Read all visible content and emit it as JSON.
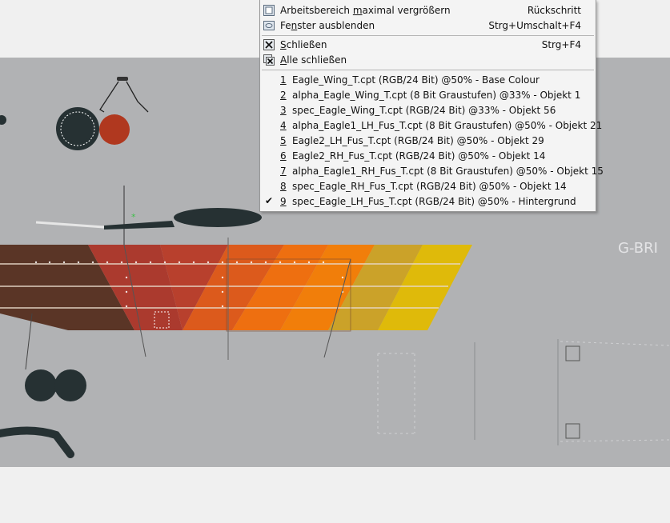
{
  "menu": {
    "window_items": [
      {
        "pre": "Arbeitsbereich ",
        "acc": "m",
        "post": "aximal vergrößern",
        "shortcut": "Rückschritt",
        "icon": "maximize-window-icon"
      },
      {
        "pre": "Fe",
        "acc": "n",
        "post": "ster ausblenden",
        "shortcut": "Strg+Umschalt+F4",
        "icon": "hide-window-icon"
      }
    ],
    "close_items": [
      {
        "pre": "",
        "acc": "S",
        "post": "chließen",
        "shortcut": "Strg+F4",
        "icon": "close-window-icon"
      },
      {
        "pre": "",
        "acc": "A",
        "post": "lle schließen",
        "shortcut": "",
        "icon": "close-all-windows-icon"
      }
    ],
    "documents": [
      {
        "num": "1",
        "label": "Eagle_Wing_T.cpt (RGB/24 Bit) @50% - Base Colour",
        "checked": false
      },
      {
        "num": "2",
        "label": "alpha_Eagle_Wing_T.cpt (8 Bit Graustufen) @33% - Objekt 1",
        "checked": false
      },
      {
        "num": "3",
        "label": "spec_Eagle_Wing_T.cpt (RGB/24 Bit) @33% - Objekt 56",
        "checked": false
      },
      {
        "num": "4",
        "label": "alpha_Eagle1_LH_Fus_T.cpt (8 Bit Graustufen) @50% - Objekt 21",
        "checked": false
      },
      {
        "num": "5",
        "label": "Eagle2_LH_Fus_T.cpt (RGB/24 Bit) @50% - Objekt 29",
        "checked": false
      },
      {
        "num": "6",
        "label": "Eagle2_RH_Fus_T.cpt (RGB/24 Bit) @50% - Objekt 14",
        "checked": false
      },
      {
        "num": "7",
        "label": "alpha_Eagle1_RH_Fus_T.cpt (8 Bit Graustufen) @50% - Objekt 15",
        "checked": false
      },
      {
        "num": "8",
        "label": "spec_Eagle_RH_Fus_T.cpt (RGB/24 Bit) @50% - Objekt 14",
        "checked": false
      },
      {
        "num": "9",
        "label": "spec_Eagle_LH_Fus_T.cpt (RGB/24 Bit) @50% - Hintergrund",
        "checked": true
      }
    ]
  },
  "canvas": {
    "registration_text": "G-BRI",
    "stripe_colors": [
      "#5a3526",
      "#ab3a2e",
      "#b8402d",
      "#dc5a1c",
      "#ee6f10",
      "#f17e0a",
      "#cba229",
      "#dfba0a"
    ],
    "background_color": "#b1b2b4"
  }
}
